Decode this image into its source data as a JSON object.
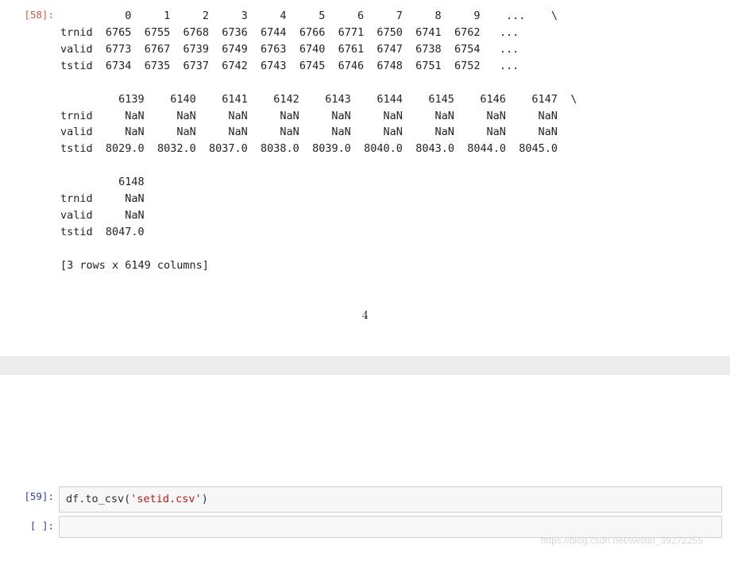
{
  "output58": {
    "prompt": "[58]:",
    "row_labels": [
      "trnid",
      "valid",
      "tstid"
    ],
    "block1": {
      "cols": [
        "0",
        "1",
        "2",
        "3",
        "4",
        "5",
        "6",
        "7",
        "8",
        "9",
        "...",
        "\\"
      ],
      "trnid": [
        "6765",
        "6755",
        "6768",
        "6736",
        "6744",
        "6766",
        "6771",
        "6750",
        "6741",
        "6762",
        "..."
      ],
      "valid": [
        "6773",
        "6767",
        "6739",
        "6749",
        "6763",
        "6740",
        "6761",
        "6747",
        "6738",
        "6754",
        "..."
      ],
      "tstid": [
        "6734",
        "6735",
        "6737",
        "6742",
        "6743",
        "6745",
        "6746",
        "6748",
        "6751",
        "6752",
        "..."
      ]
    },
    "block2": {
      "cols": [
        "6139",
        "6140",
        "6141",
        "6142",
        "6143",
        "6144",
        "6145",
        "6146",
        "6147",
        "\\"
      ],
      "trnid": [
        "NaN",
        "NaN",
        "NaN",
        "NaN",
        "NaN",
        "NaN",
        "NaN",
        "NaN",
        "NaN"
      ],
      "valid": [
        "NaN",
        "NaN",
        "NaN",
        "NaN",
        "NaN",
        "NaN",
        "NaN",
        "NaN",
        "NaN"
      ],
      "tstid": [
        "8029.0",
        "8032.0",
        "8037.0",
        "8038.0",
        "8039.0",
        "8040.0",
        "8043.0",
        "8044.0",
        "8045.0"
      ]
    },
    "block3": {
      "cols": [
        "6148"
      ],
      "trnid": [
        "NaN"
      ],
      "valid": [
        "NaN"
      ],
      "tstid": [
        "8047.0"
      ]
    },
    "summary": "[3 rows x 6149 columns]"
  },
  "page_number": "4",
  "input59": {
    "prompt": "[59]:",
    "code_prefix": "df.to_csv(",
    "code_string": "'setid.csv'",
    "code_suffix": ")"
  },
  "input_blank": {
    "prompt": "[ ]:"
  },
  "watermark": "https://blog.csdn.net/weixin_39272255"
}
